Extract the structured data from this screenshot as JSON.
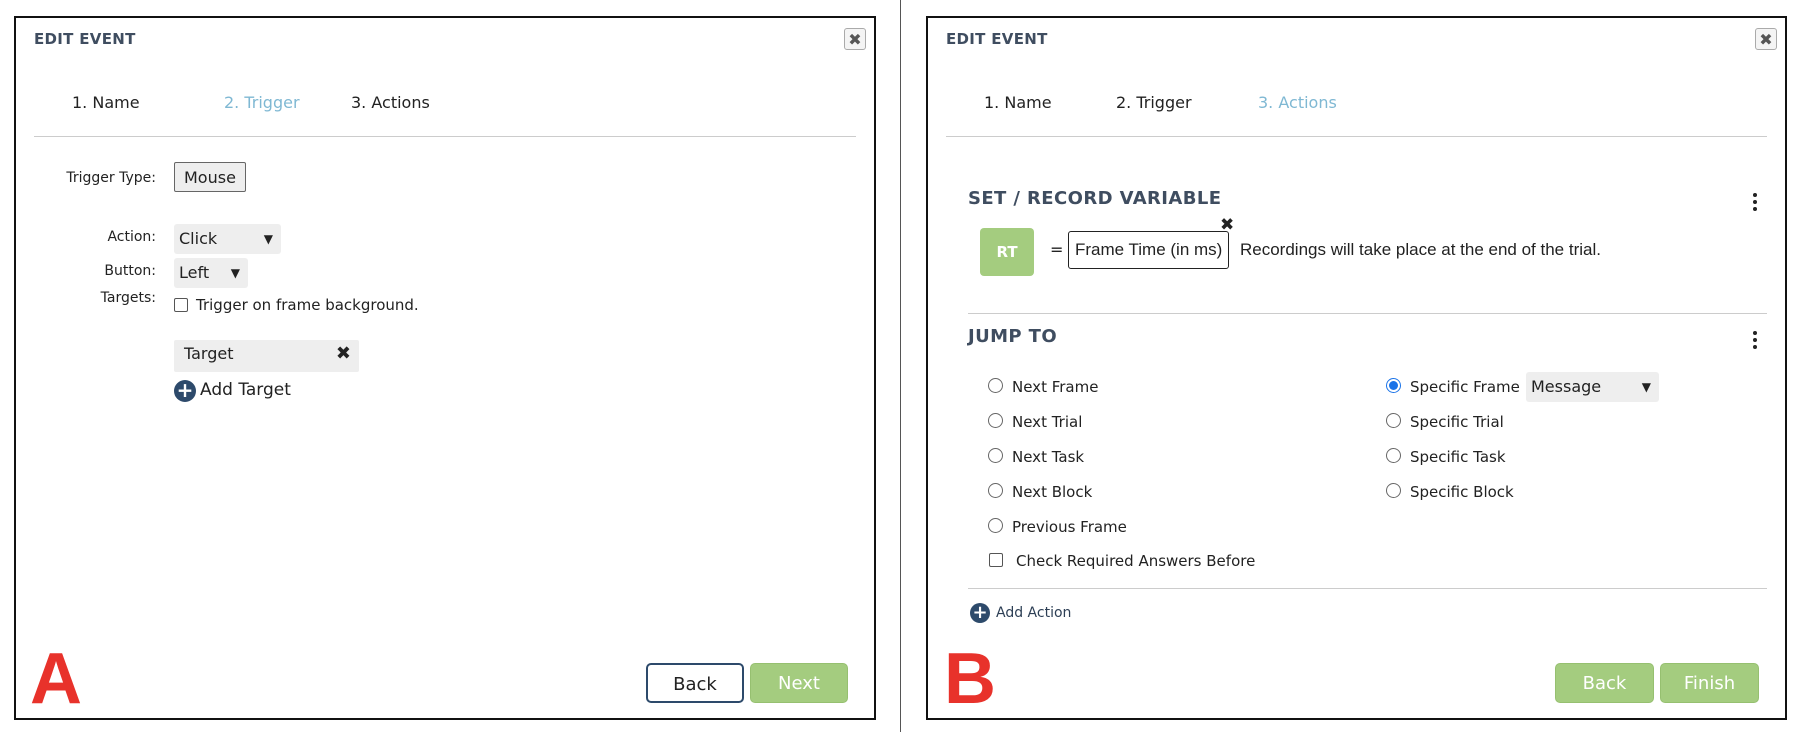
{
  "panel_a": {
    "title": "EDIT EVENT",
    "close_glyph": "✖",
    "tabs": [
      {
        "label": "1. Name",
        "active": false
      },
      {
        "label": "2. Trigger",
        "active": true
      },
      {
        "label": "3. Actions",
        "active": false
      }
    ],
    "trigger_type_label": "Trigger Type:",
    "trigger_type_value": "Mouse",
    "action_label": "Action:",
    "action_value": "Click",
    "button_label": "Button:",
    "button_value": "Left",
    "targets_label": "Targets:",
    "frame_background_checkbox": {
      "label": "Trigger on frame background.",
      "checked": false
    },
    "target_item": "Target",
    "add_target_label": "Add Target",
    "back_label": "Back",
    "next_label": "Next",
    "letter": "A"
  },
  "panel_b": {
    "title": "EDIT EVENT",
    "close_glyph": "✖",
    "tabs": [
      {
        "label": "1. Name",
        "active": false
      },
      {
        "label": "2. Trigger",
        "active": false
      },
      {
        "label": "3. Actions",
        "active": true
      }
    ],
    "set_record": {
      "title": "SET / RECORD VARIABLE",
      "variable": "RT",
      "equals": "=",
      "value": "Frame Time (in ms)",
      "note": "Recordings will take place at the end of the trial."
    },
    "jump_to": {
      "title": "JUMP TO",
      "left_options": [
        "Next Frame",
        "Next Trial",
        "Next Task",
        "Next Block",
        "Previous Frame"
      ],
      "right_options": [
        "Specific Frame",
        "Specific Trial",
        "Specific Task",
        "Specific Block"
      ],
      "selected": "Specific Frame",
      "frame_select_value": "Message",
      "check_required": {
        "label": "Check Required Answers Before",
        "checked": false
      }
    },
    "add_action_label": "Add Action",
    "back_label": "Back",
    "finish_label": "Finish",
    "letter": "B"
  },
  "colors": {
    "accent_tab": "#7fb8d3",
    "green_button": "#a4cc7f",
    "navy": "#2d4a6b",
    "letter_red": "#e8322b",
    "radio_blue": "#1a73e8"
  }
}
